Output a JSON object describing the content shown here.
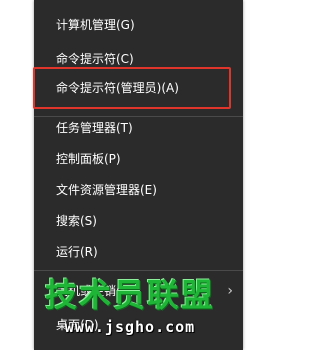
{
  "menu": {
    "items": [
      {
        "label": "计算机管理(G)"
      },
      {
        "label": "命令提示符(C)"
      },
      {
        "label": "命令提示符(管理员)(A)"
      },
      {
        "label": "任务管理器(T)"
      },
      {
        "label": "控制面板(P)"
      },
      {
        "label": "文件资源管理器(E)"
      },
      {
        "label": "搜索(S)"
      },
      {
        "label": "运行(R)"
      },
      {
        "label": "关机或注销(U)"
      },
      {
        "label": "桌面(D)"
      }
    ],
    "submenu_indicator": "›"
  },
  "watermark": {
    "title": "技术员联盟",
    "url": "www.jsgho.com"
  },
  "colors": {
    "menu_bg": "#2b2b2b",
    "highlight_border": "#e0352b",
    "watermark_green": "#1fb536"
  }
}
